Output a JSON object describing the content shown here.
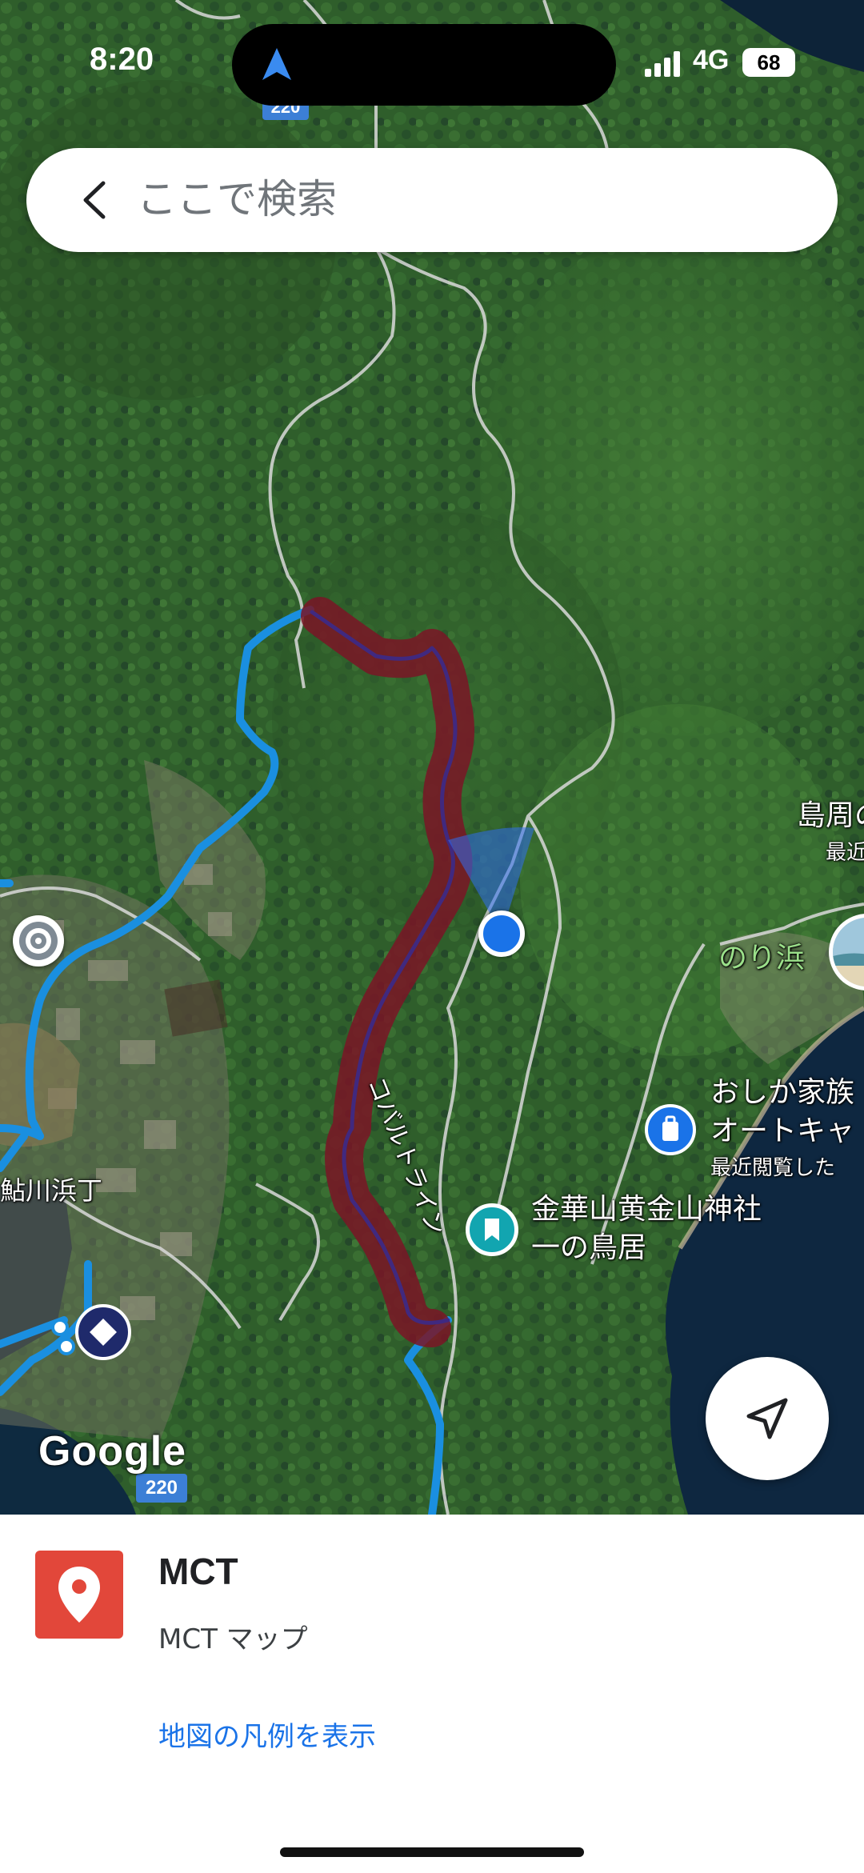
{
  "status_bar": {
    "time": "8:20",
    "network": "4G",
    "battery": "68"
  },
  "search": {
    "placeholder": "ここで検索"
  },
  "map": {
    "road_shield_top": "220",
    "road_shield_bottom": "220",
    "labels": {
      "island_cut_line1": "島周の",
      "island_cut_line2": "最近",
      "beach": "のり浜",
      "campsite_line1": "おしか家族",
      "campsite_line2": "オートキャ",
      "campsite_line3": "最近閲覧した",
      "shrine_line1": "金華山黄金山神社",
      "shrine_line2": "一の鳥居",
      "town": "鮎川浜丁",
      "road": "コバルトライン"
    },
    "google_logo": "Google",
    "colors": {
      "route_blue": "#1a8fe0",
      "track_red": "#7a1526",
      "location_dot": "#1a73e8"
    }
  },
  "sheet": {
    "title": "MCT",
    "subtitle": "MCT マップ",
    "legend_link": "地図の凡例を表示"
  }
}
